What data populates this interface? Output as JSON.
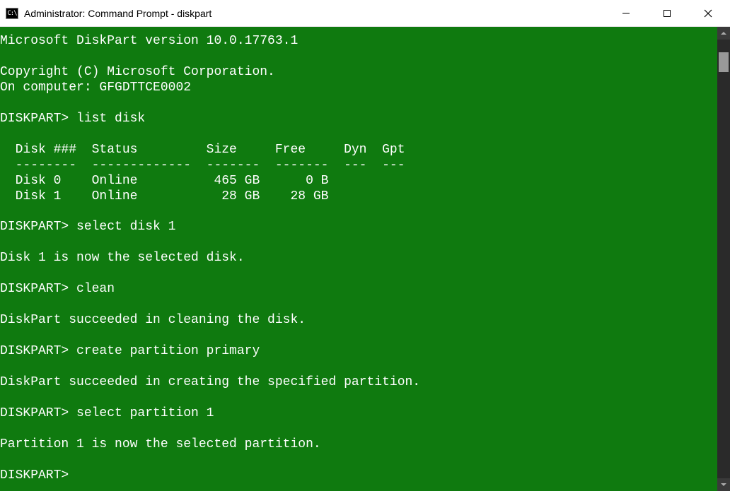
{
  "window": {
    "title": "Administrator: Command Prompt - diskpart",
    "icon_label": "cmd-icon"
  },
  "console": {
    "lines": [
      "Microsoft DiskPart version 10.0.17763.1",
      "",
      "Copyright (C) Microsoft Corporation.",
      "On computer: GFGDTTCE0002",
      "",
      "DISKPART> list disk",
      "",
      "  Disk ###  Status         Size     Free     Dyn  Gpt",
      "  --------  -------------  -------  -------  ---  ---",
      "  Disk 0    Online          465 GB      0 B",
      "  Disk 1    Online           28 GB    28 GB",
      "",
      "DISKPART> select disk 1",
      "",
      "Disk 1 is now the selected disk.",
      "",
      "DISKPART> clean",
      "",
      "DiskPart succeeded in cleaning the disk.",
      "",
      "DISKPART> create partition primary",
      "",
      "DiskPart succeeded in creating the specified partition.",
      "",
      "DISKPART> select partition 1",
      "",
      "Partition 1 is now the selected partition.",
      "",
      "DISKPART>"
    ]
  }
}
